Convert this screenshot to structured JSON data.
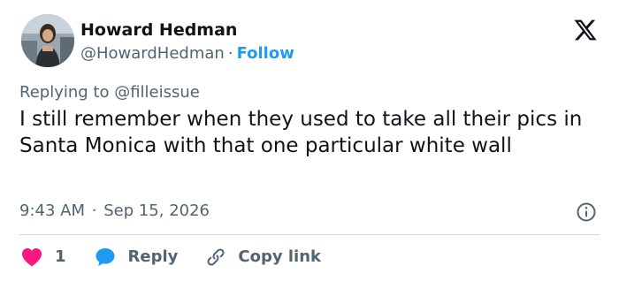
{
  "author": {
    "name": "Howard Hedman",
    "handle": "@HowardHedman",
    "separator": "·",
    "follow_label": "Follow"
  },
  "reply_context": "Replying to @filleissue",
  "tweet": {
    "text": "I still remember when they used to take all their pics in Santa Monica with that one particular white wall",
    "time": "9:43 AM",
    "separator": "·",
    "date": "Sep 15, 2026"
  },
  "actions": {
    "like_count": "1",
    "reply_label": "Reply",
    "copy_link_label": "Copy link"
  },
  "icons": {
    "logo": "x-logo-icon",
    "info": "info-icon",
    "like": "heart-icon",
    "reply": "speech-bubble-icon",
    "copy": "link-icon"
  },
  "colors": {
    "text_primary": "#0f1419",
    "text_secondary": "#536471",
    "link": "#1d9bf0",
    "like": "#f91880",
    "divider": "#cfd9de"
  }
}
